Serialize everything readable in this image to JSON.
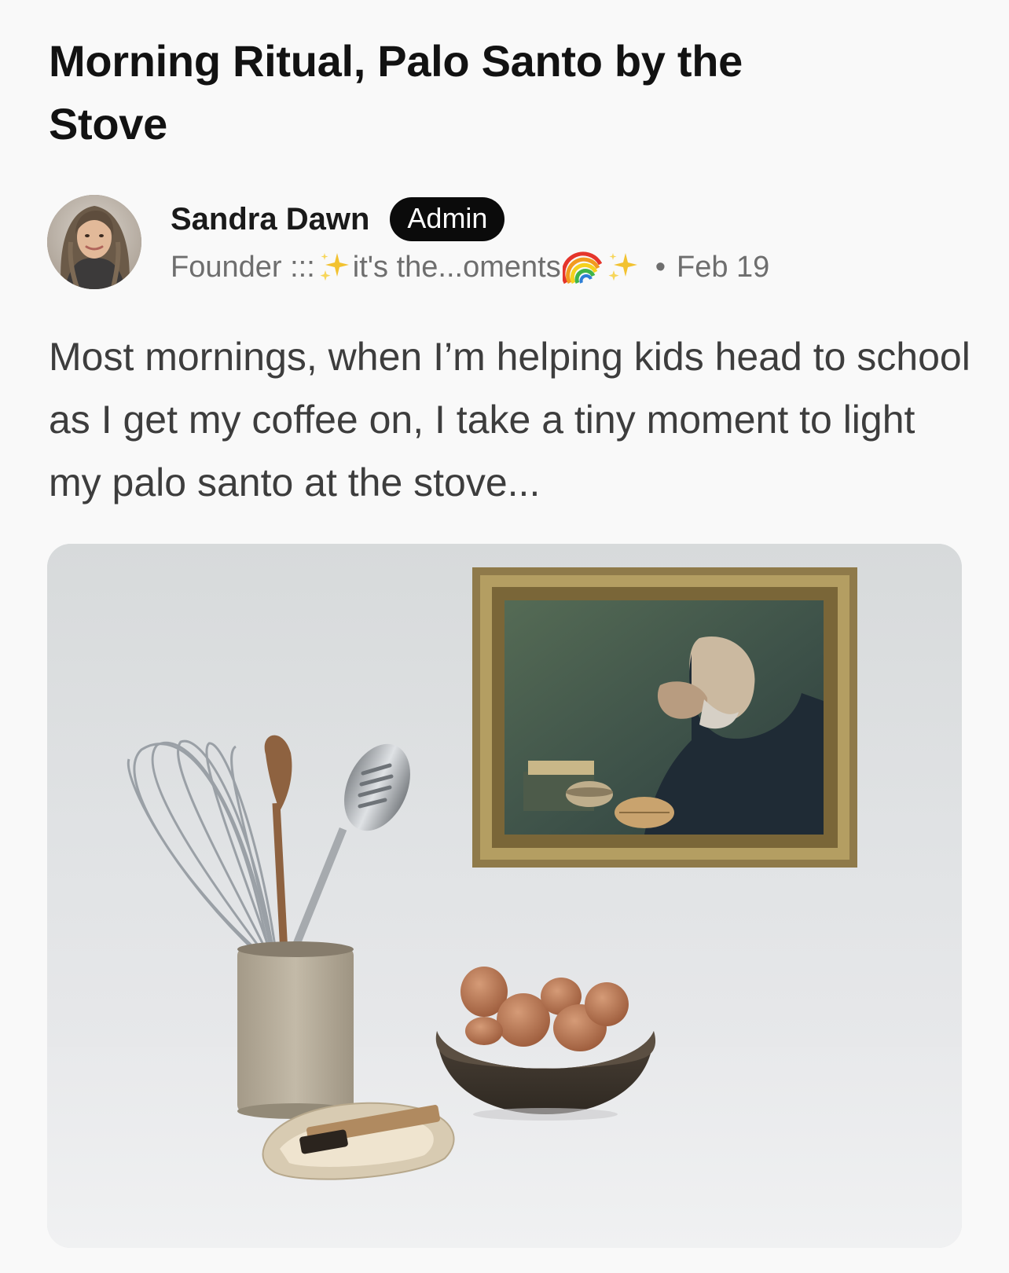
{
  "post": {
    "title": "Morning Ritual, Palo Santo by the Stove",
    "author": {
      "name": "Sandra Dawn",
      "badge": "Admin",
      "meta_prefix": "Founder ::: ",
      "meta_middle": "it's the...oments",
      "separator": "•",
      "date": "Feb 19",
      "avatar_icon": "avatar-photo"
    },
    "body": "Most mornings, when I’m helping kids head to school as I get my coffee on, I take a tiny moment to light my palo santo at the stove...",
    "image": {
      "icons": [
        "whisk-icon",
        "wooden-spoon-icon",
        "slotted-spoon-icon",
        "framed-painting-icon",
        "egg-bowl-icon",
        "palo-santo-shell-icon"
      ]
    }
  },
  "colors": {
    "background": "#f9f9f9",
    "title": "#121212",
    "meta": "#6e6e6e",
    "body": "#3d3d3d",
    "badge_bg": "#0b0b0b",
    "badge_text": "#ffffff"
  }
}
